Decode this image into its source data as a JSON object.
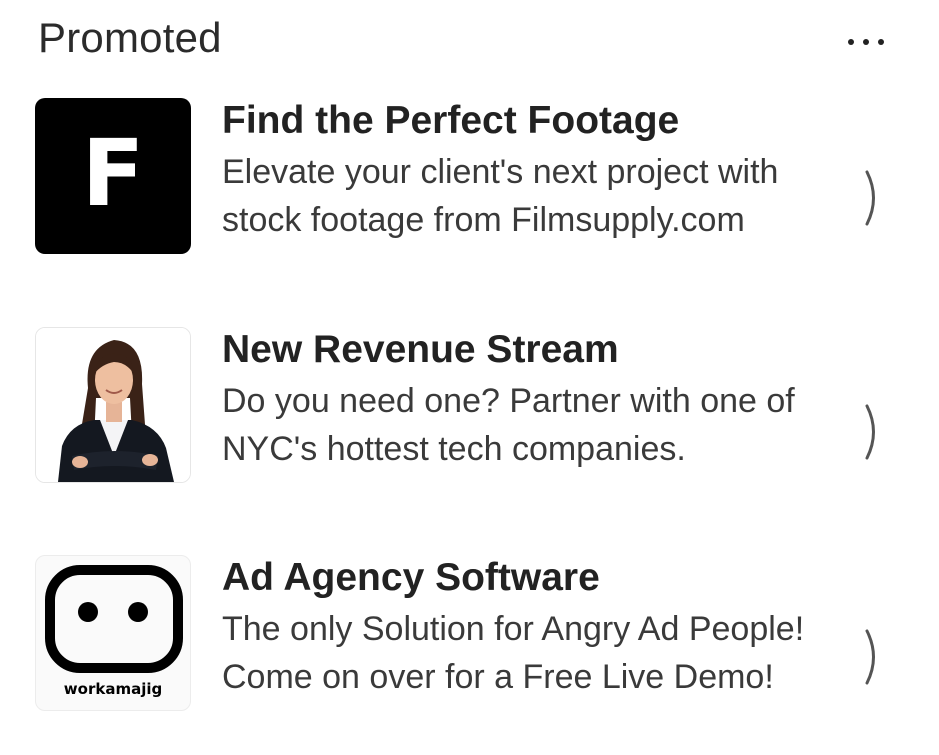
{
  "header": {
    "title": "Promoted",
    "more_icon": "more-horizontal-icon"
  },
  "ads": [
    {
      "logo": {
        "type": "letter",
        "letter": "F",
        "background": "#000000",
        "foreground": "#ffffff"
      },
      "title": "Find the Perfect Footage",
      "description": "Elevate your client's next project with stock footage from Filmsupply.com",
      "chevron_icon": "chevron-right-icon"
    },
    {
      "logo": {
        "type": "photo",
        "subject": "businesswoman-portrait"
      },
      "title": "New Revenue Stream",
      "description": "Do you need one? Partner with one of NYC's hottest tech companies.",
      "chevron_icon": "chevron-right-icon"
    },
    {
      "logo": {
        "type": "robot-face",
        "wordmark": "workamajig"
      },
      "title": "Ad Agency Software",
      "description": "The only Solution for Angry Ad People! Come on over for a Free Live Demo!",
      "chevron_icon": "chevron-right-icon"
    }
  ],
  "colors": {
    "text_primary": "#222222",
    "text_secondary": "#3a3a3a",
    "background": "#ffffff"
  }
}
